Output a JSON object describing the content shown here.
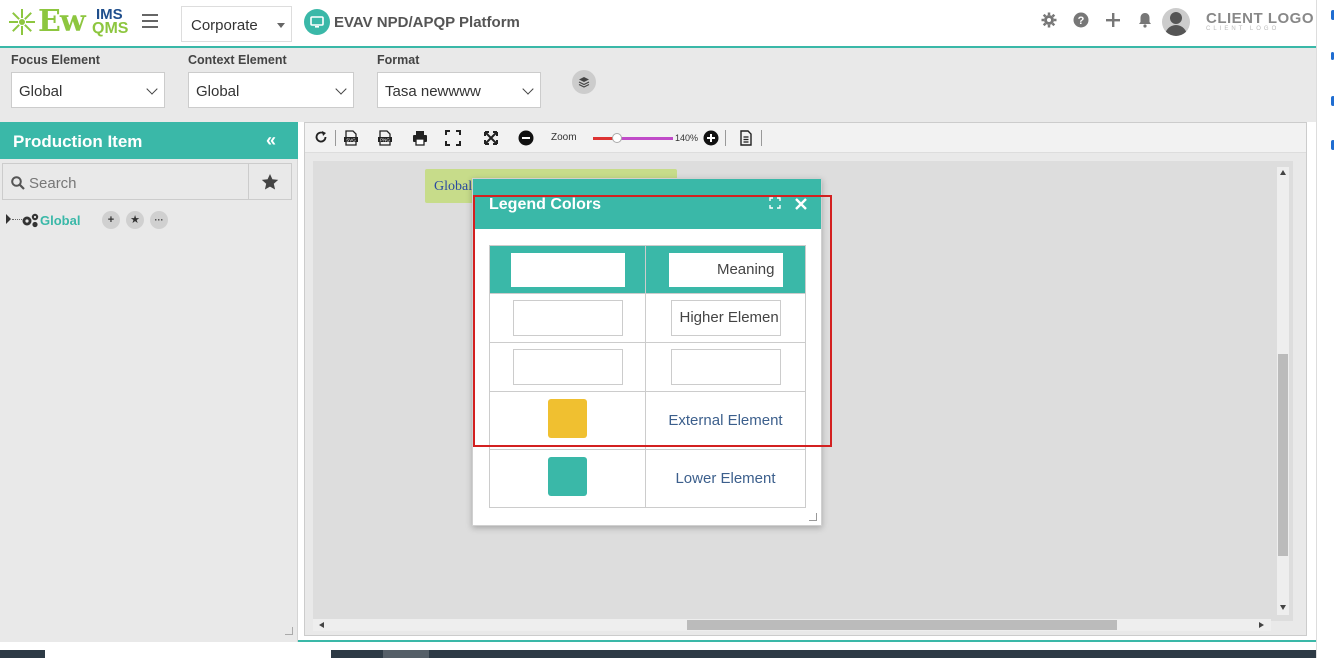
{
  "header": {
    "logo_ew": "Ew",
    "logo_ims": "IMS",
    "logo_qms": "QMS",
    "org_select": "Corporate",
    "platform_title": "EVAV NPD/APQP Platform",
    "client_logo": "CLIENT LOGO",
    "client_logo_sub": "CLIENT LOGO"
  },
  "filters": {
    "focus_label": "Focus Element",
    "focus_value": "Global",
    "context_label": "Context Element",
    "context_value": "Global",
    "format_label": "Format",
    "format_value": "Tasa newwww"
  },
  "left_panel": {
    "title": "Production Item",
    "collapse_glyph": "«",
    "search_placeholder": "Search",
    "tree": [
      {
        "label": "Global"
      }
    ],
    "tree_buttons": [
      "+",
      "★",
      "···"
    ]
  },
  "toolbar": {
    "zoom_label": "Zoom",
    "zoom_value": "140%"
  },
  "diagram": {
    "node_label": "Global"
  },
  "legend_dialog": {
    "title": "Legend Colors",
    "header": {
      "color": "",
      "meaning": "Meaning"
    },
    "rows": [
      {
        "color_value": "",
        "meaning_value": "Higher Elemen"
      },
      {
        "color_value": "",
        "meaning_value": ""
      }
    ],
    "swatch_rows": [
      {
        "color": "#f0c030",
        "label": "External Element"
      },
      {
        "color": "#3ab8a8",
        "label": "Lower Element"
      }
    ]
  },
  "colors": {
    "accent": "#3ab8a8",
    "highlight": "#d32020",
    "node_fill": "#c7dc8a"
  }
}
